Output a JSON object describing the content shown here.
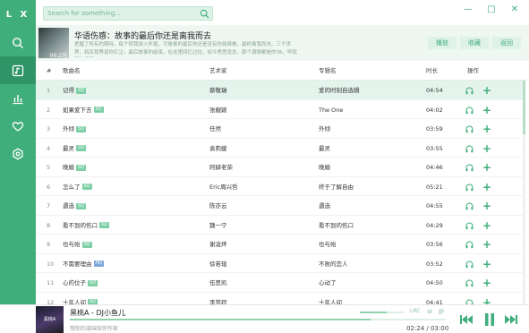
{
  "app": {
    "logo": "L X"
  },
  "search": {
    "placeholder": "Search for something..."
  },
  "window": {
    "minimize": "—",
    "maximize": "□",
    "close": "✕"
  },
  "sidebar": {
    "items": [
      "search",
      "song-list",
      "leaderboard",
      "favorites",
      "settings"
    ]
  },
  "playlist": {
    "cover_count": "99.2万",
    "title": "华语伤感：故事的最后你还是离我而去",
    "description": "把握了所有的期待，每个转我掉入怀抱，可故事的最后你还是没有你抉择做，最终离我而去。三千世界，鸦杀我等皆你红尘。最后故事的结束，在这里回忆过往，如今思思念念，那个满眼都是的TA，早就不在了吧...",
    "buttons": {
      "play": "播放",
      "collect": "收藏",
      "back": "返回"
    }
  },
  "table": {
    "headers": {
      "index": "#",
      "name": "歌曲名",
      "artist": "艺术家",
      "album": "专辑名",
      "duration": "时长",
      "ops": "操作"
    },
    "rows": [
      {
        "index": "1",
        "name": "记得",
        "badge": "SQ",
        "artist": "蔡敬瑞",
        "album": "爱的时刻自选辑",
        "duration": "04:54"
      },
      {
        "index": "2",
        "name": "如果爱下去",
        "badge": "SQ",
        "artist": "张靓颖",
        "album": "The One",
        "duration": "04:02"
      },
      {
        "index": "3",
        "name": "外倾",
        "badge": "SQ",
        "artist": "任然",
        "album": "外倾",
        "duration": "03:59"
      },
      {
        "index": "4",
        "name": "最灵",
        "badge": "SQ",
        "artist": "袁莉媛",
        "album": "最灵",
        "duration": "03:55"
      },
      {
        "index": "5",
        "name": "晚婚",
        "badge": "SQ",
        "artist": "阿肆老荣",
        "album": "晚婚",
        "duration": "04:46"
      },
      {
        "index": "6",
        "name": "怎么了",
        "badge": "SQ",
        "artist": "Eric周兴哲",
        "album": "终于了解自由",
        "duration": "05:21"
      },
      {
        "index": "7",
        "name": "遇选",
        "badge": "SQ",
        "artist": "陈亦云",
        "album": "遇选",
        "duration": "04:55"
      },
      {
        "index": "8",
        "name": "看不到的伤口",
        "badge": "SQ",
        "artist": "魏一宁",
        "album": "看不到的伤口",
        "duration": "04:29"
      },
      {
        "index": "9",
        "name": "也与始",
        "badge": "SQ",
        "artist": "谢凌烨",
        "album": "也与始",
        "duration": "03:56"
      },
      {
        "index": "10",
        "name": "不需要理由",
        "badge": "HQ",
        "artist": "徐若瑄",
        "album": "不败的恋人",
        "duration": "03:52"
      },
      {
        "index": "11",
        "name": "心的位子",
        "badge": "SQ",
        "artist": "伍思凯",
        "album": "心动了",
        "duration": "04:50"
      },
      {
        "index": "12",
        "name": "十年人间",
        "badge": "SQ",
        "artist": "李常超",
        "album": "十年人间",
        "duration": "04:41"
      }
    ]
  },
  "player": {
    "cover_text": "黑桃A",
    "title": "黑桃A - DJ小鱼儿",
    "subtitle": "想你的滋味陪你作家",
    "lrc": "LRC",
    "time": "02:24 / 03:00",
    "progress_fraction": 0.8,
    "volume_fraction": 0.6
  },
  "colors": {
    "accent": "#3fae7a",
    "accent_dark": "#2f9566",
    "accent_light": "#dff2e8"
  }
}
